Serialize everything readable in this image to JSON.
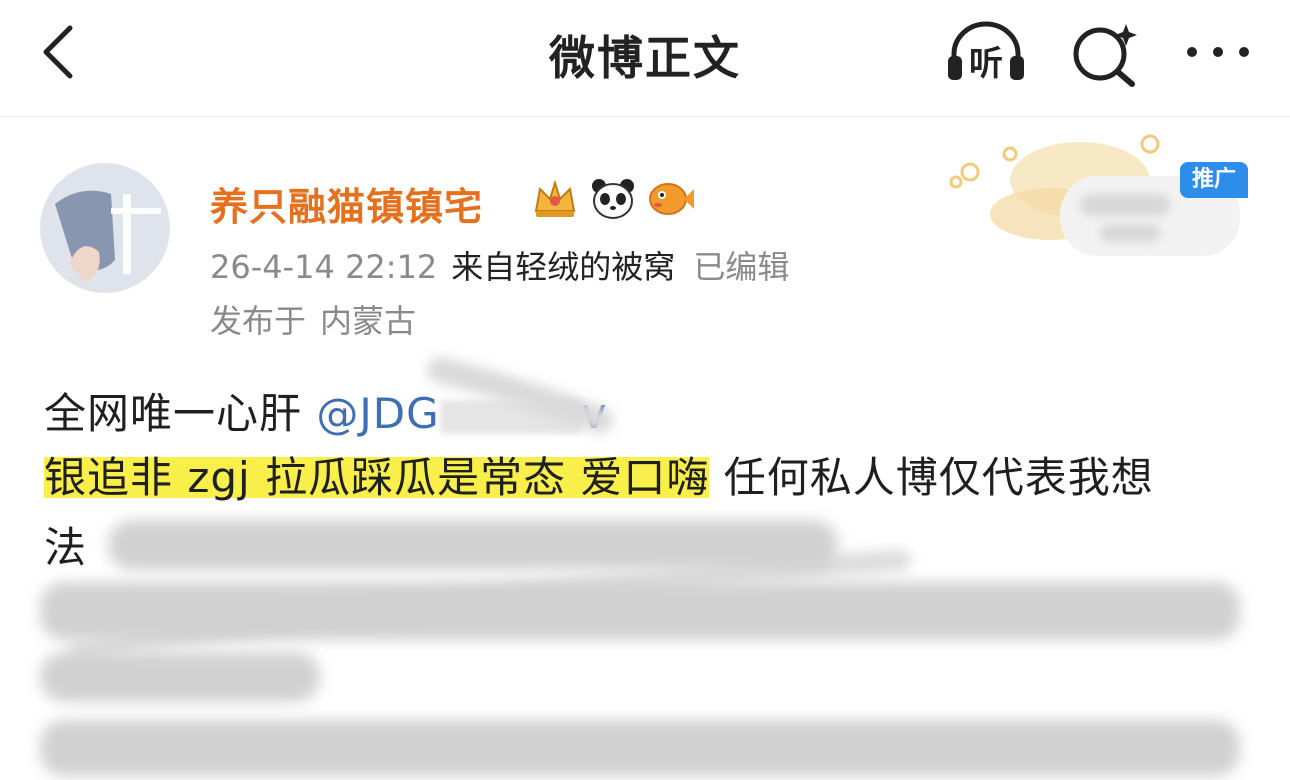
{
  "header": {
    "title": "微博正文",
    "listen_label": "听",
    "icons": {
      "back": "back-chevron-icon",
      "search": "sparkle-search-icon",
      "more": "more-dots-icon"
    }
  },
  "post": {
    "author": {
      "name": "养只融猫镇镇宅",
      "name_color": "#e5711e"
    },
    "badges": [
      "crown-badge-icon",
      "panda-badge-icon",
      "pufferfish-badge-icon"
    ],
    "time": "26-4-14 22:12",
    "source_prefix": "来自",
    "source": "轻绒的被窝",
    "edited": "已编辑",
    "location_prefix": "发布于",
    "location": "内蒙古",
    "promo_tag": "推广",
    "text": {
      "line1_pre": "全网唯一心肝 ",
      "mention_visible": "@JDG",
      "mention_tail": "v",
      "line2_highlight": "银追非 zgj 拉瓜踩瓜是常态 爱口嗨",
      "line2_rest": " 任何私人博仅代表我想",
      "line3_visible": "法"
    },
    "highlight_color": "#f9ef4a",
    "mention_color": "#3e6fb5"
  }
}
